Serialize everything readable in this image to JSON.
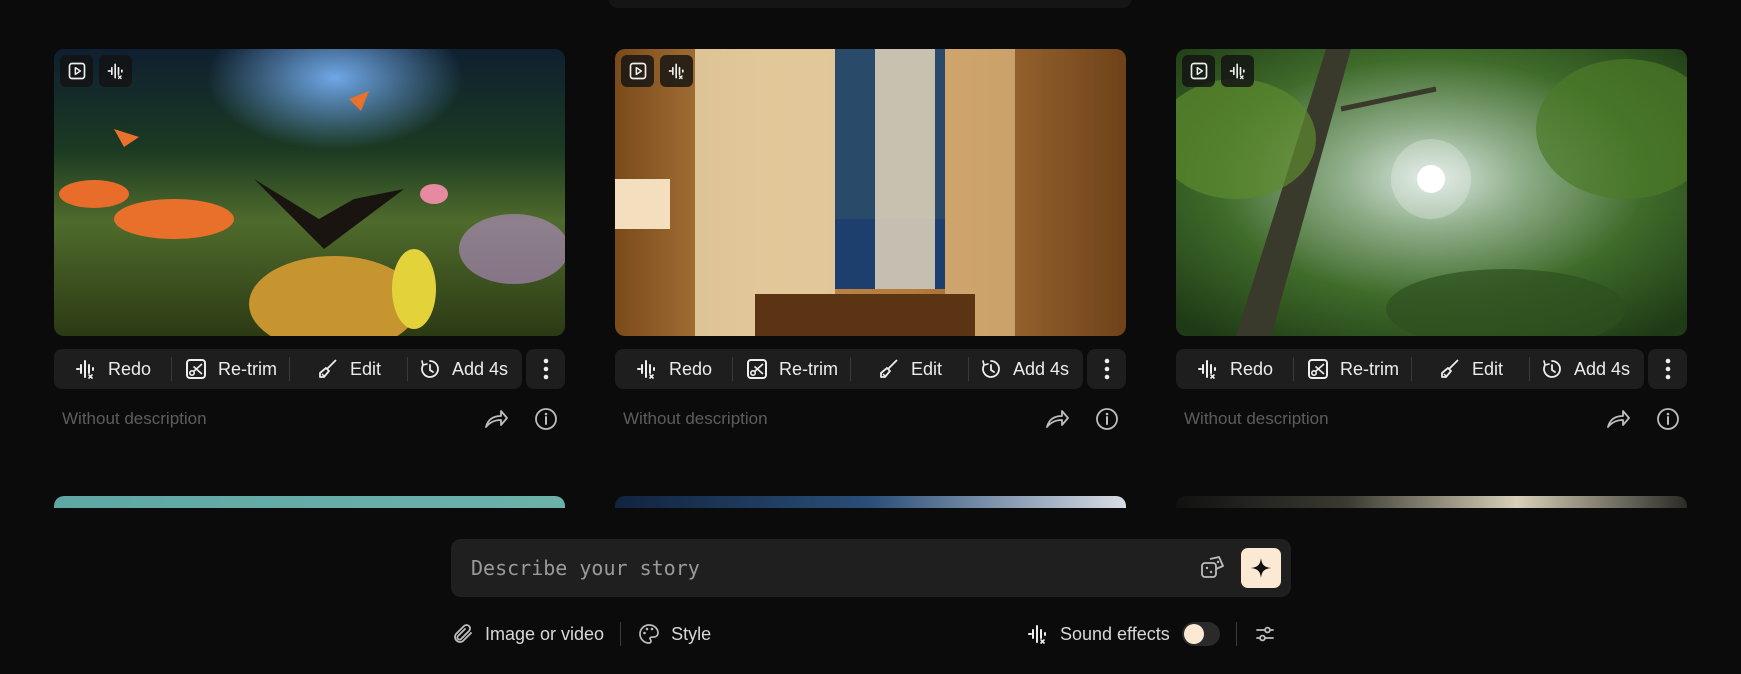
{
  "cards": [
    {
      "toolbar": {
        "redo": "Redo",
        "retrim": "Re-trim",
        "edit": "Edit",
        "add": "Add 4s"
      },
      "description": "Without description"
    },
    {
      "toolbar": {
        "redo": "Redo",
        "retrim": "Re-trim",
        "edit": "Edit",
        "add": "Add 4s"
      },
      "description": "Without description"
    },
    {
      "toolbar": {
        "redo": "Redo",
        "retrim": "Re-trim",
        "edit": "Edit",
        "add": "Add 4s"
      },
      "description": "Without description"
    }
  ],
  "prompt": {
    "placeholder": "Describe your story"
  },
  "bottom": {
    "attach_label": "Image or video",
    "style_label": "Style",
    "sound_label": "Sound effects",
    "sound_enabled": false
  },
  "colors": {
    "background": "#0b0b0b",
    "panel": "#1e1e1e",
    "accent": "#fbe9d3"
  }
}
